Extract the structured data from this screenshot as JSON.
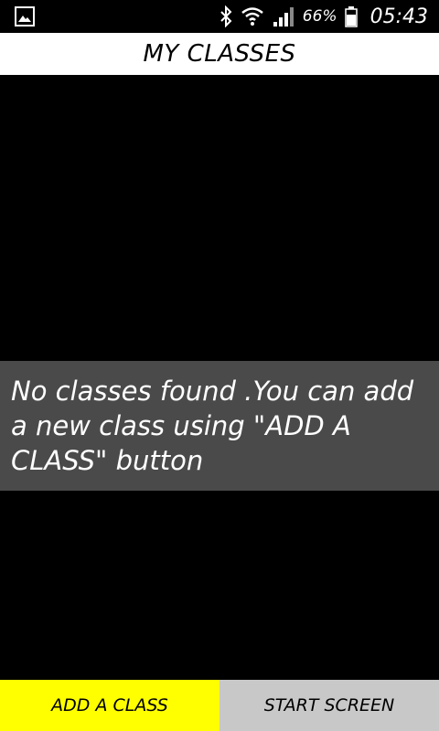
{
  "status_bar": {
    "icons": [
      "image-icon",
      "bluetooth-icon",
      "wifi-icon",
      "signal-icon",
      "battery-icon"
    ],
    "battery": "66%",
    "time": "05:43"
  },
  "header": {
    "title": "MY CLASSES"
  },
  "main": {
    "empty_message": "No classes found .You can add a new class using \"ADD A CLASS\" button"
  },
  "footer": {
    "add_class_label": "ADD A CLASS",
    "start_screen_label": "START SCREEN"
  },
  "colors": {
    "add_button_bg": "#ffff00",
    "start_button_bg": "#c8c8c8",
    "message_bg": "#4a4a4a",
    "title_bg": "#ffffff",
    "background": "#000000"
  }
}
